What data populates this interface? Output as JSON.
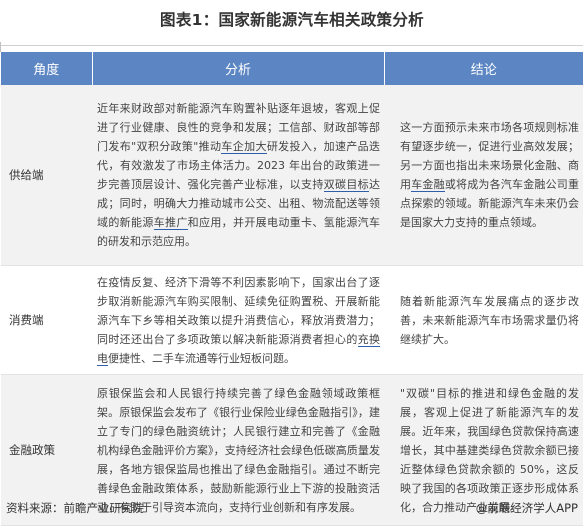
{
  "title": "图表1：国家新能源汽车相关政策分析",
  "header": {
    "col1": "角度",
    "col2": "分析",
    "col3": "结论"
  },
  "rows": [
    {
      "category": "供给端",
      "analysis": [
        {
          "t": "近年来财政部对新能源汽车购置补贴逐年退坡，客观上促进了行业健康、良性的竞争和发展；工信部、财政部等部门发布\"双积分政策\"推动"
        },
        {
          "t": "车企加大",
          "u": true
        },
        {
          "t": "研发投入，加速产品迭代，有效激发了市场主体活力。2023 年出台的政策进一步完善顶层设计、强化完善产业标准，以支持"
        },
        {
          "t": "双碳目标",
          "u": true
        },
        {
          "t": "达成；同时，明确大力推动城市公交、出租、物流配送等领域的新能源"
        },
        {
          "t": "车推广",
          "u": true
        },
        {
          "t": "和应用，并开展电动重卡、氢能源汽车的研发和示范应用。"
        }
      ],
      "conclusion": [
        {
          "t": "这一方面预示未来市场各项规则标准有望逐步统一，促进行业高效发展；另一方面也指出未来场景化金融、商用"
        },
        {
          "t": "车金融",
          "u": true
        },
        {
          "t": "或将成为各汽车金融公司重点探索的领域。新能源汽车未来仍会是国家大力支持的重点领域。"
        }
      ]
    },
    {
      "category": "消费端",
      "analysis": [
        {
          "t": "在疫情反复、经济下滑等不利因素影响下，国家出台了逐步取消新能源汽车购买限制、延续免征购置税、开展新能源汽车下乡等相关政策以提升消费信心，释放消费潜力；同时还还出台了多项政策以解决新能源消费者担心的"
        },
        {
          "t": "充换电",
          "u": true
        },
        {
          "t": "便捷性、二手车流通等行业短板问题。"
        }
      ],
      "conclusion": [
        {
          "t": "随着新能源汽车发展痛点的逐步改善，未来新能源汽车市场需求量仍将继续扩大。"
        }
      ]
    },
    {
      "category": "金融政策",
      "analysis": [
        {
          "t": "原银保监会和人民银行持续完善了绿色金融领域政策框架。原银保监会发布了《银行业保险业绿色金融指引》，建立了专门的绿色融资统计；人民银行建立和完善了《金融机构绿色金融评价方案》，支持经济社会绿色低碳高质量发展，各地方银保监局也推出了绿色金融指引。通过不断完善绿色金融政策体系，鼓励新能源行业上下游的投融资活动，有助于引导资本流向，支持行业创新和有序发展。"
        }
      ],
      "conclusion": [
        {
          "t": "\"双碳\"目标的推进和绿色金融的发展，客观上促进了新能源汽车的发展。近年来，我国绿色贷款保持高速增长，其中基建类绿色贷款余额已接近整体绿色贷款余额的 50%，这反映了我国的各项政策正逐步形成体系化，合力推动产业发展。"
        }
      ]
    }
  ],
  "footer": {
    "source": "资料来源：前瞻产业研究院",
    "brand": "@前瞻经济学人APP"
  }
}
